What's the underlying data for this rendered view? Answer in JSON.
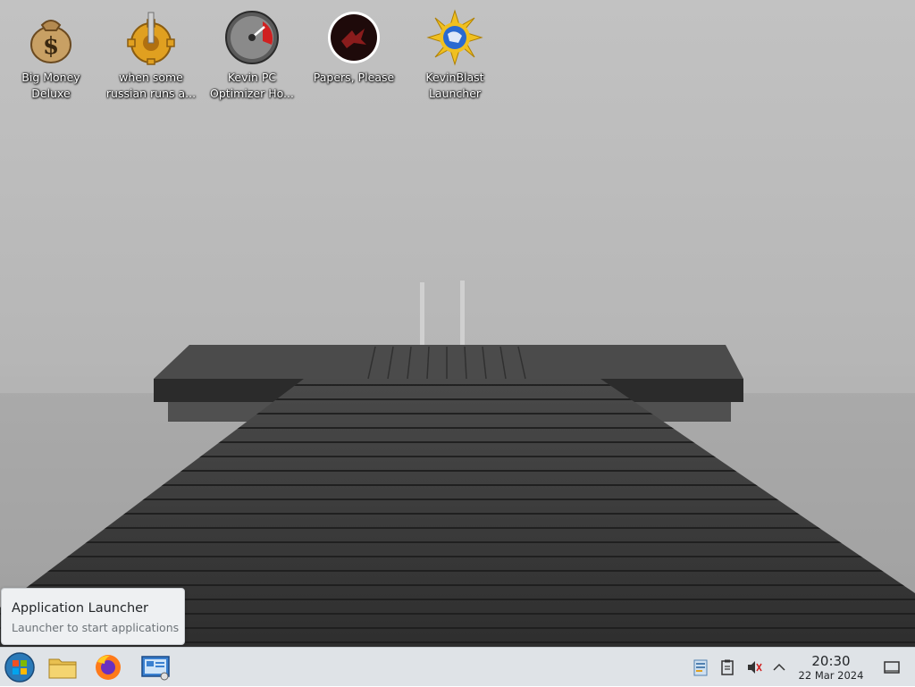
{
  "desktop": {
    "icons": [
      {
        "label": "Big Money\nDeluxe",
        "icon": "money-bag-icon"
      },
      {
        "label": "when some\nrussian runs a...",
        "icon": "gear-icon"
      },
      {
        "label": "Kevin PC\nOptimizer Ho...",
        "icon": "speedometer-icon"
      },
      {
        "label": "Papers, Please",
        "icon": "papers-please-icon"
      },
      {
        "label": "KevinBlast\nLauncher",
        "icon": "sun-globe-icon"
      }
    ]
  },
  "tooltip": {
    "title": "Application Launcher",
    "subtitle": "Launcher to start applications"
  },
  "taskbar": {
    "launchers": [
      "start-orb-icon",
      "folder-icon",
      "firefox-icon",
      "remote-desktop-icon"
    ],
    "tray": [
      "clipboard-note-icon",
      "clipboard-icon",
      "volume-muted-icon",
      "chevron-up-icon"
    ],
    "clock": {
      "time": "20:30",
      "date": "22 Mar 2024"
    },
    "show_desktop": "show-desktop-icon"
  },
  "colors": {
    "taskbar_bg": "#dfe3e7",
    "tooltip_bg": "#eef0f2",
    "text": "#232629"
  }
}
